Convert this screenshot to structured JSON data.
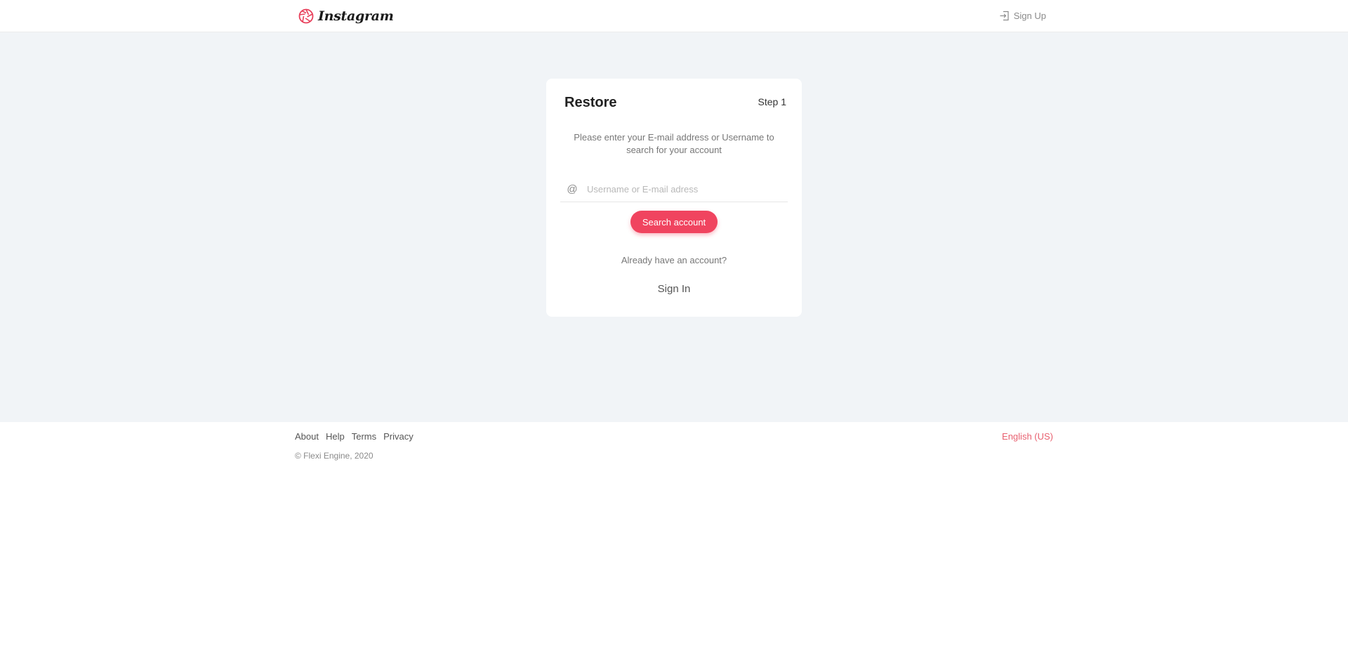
{
  "header": {
    "logo_text": "Instagram",
    "signup_label": "Sign Up"
  },
  "card": {
    "title": "Restore",
    "step": "Step 1",
    "description": "Please enter your E-mail address or Username to search for your account",
    "input": {
      "icon": "@",
      "placeholder": "Username or E-mail adress",
      "value": ""
    },
    "search_button": "Search account",
    "already_text": "Already have an account?",
    "signin_label": "Sign In"
  },
  "footer": {
    "links": [
      "About",
      "Help",
      "Terms",
      "Privacy"
    ],
    "copyright": "© Flexi Engine, 2020",
    "language": "English (US)"
  },
  "colors": {
    "accent": "#f0445f",
    "background": "#f1f4f7",
    "language_link": "#e8606f"
  },
  "icons": {
    "logo": "aperture-logo-icon",
    "signup": "sign-in-icon",
    "input": "at-sign-icon"
  }
}
